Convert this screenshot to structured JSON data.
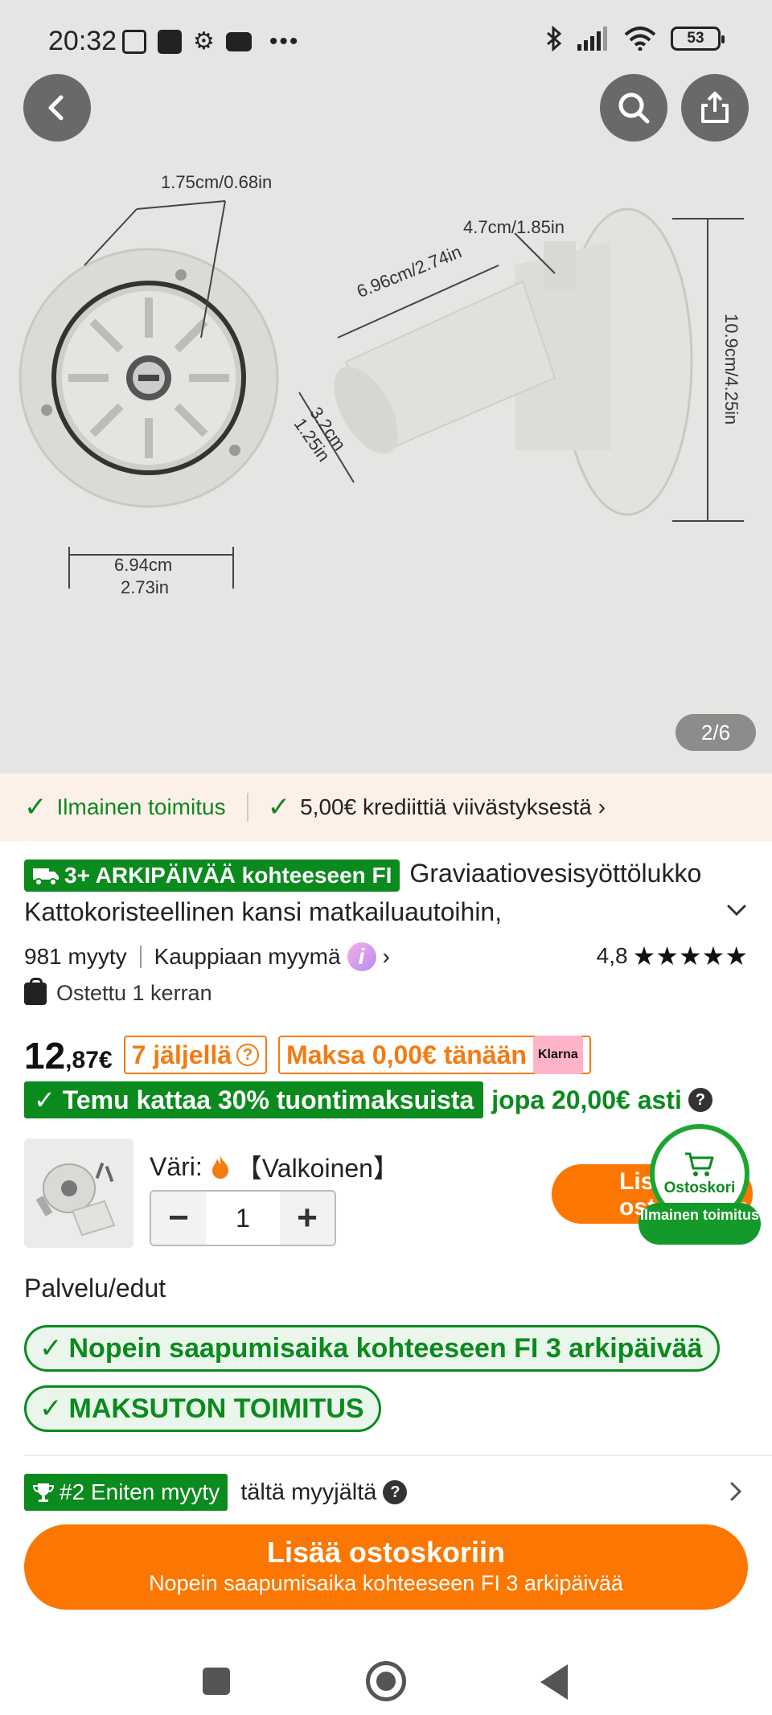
{
  "status_bar": {
    "time": "20:32",
    "battery": "53"
  },
  "gallery": {
    "counter": "2/6",
    "dimensions": {
      "top_left": "1.75cm/0.68in",
      "top_right": "4.7cm/1.85in",
      "diagonal": "6.96cm/2.74in",
      "height": "10.9cm/4.25in",
      "side": "3.2cm\n1.25in",
      "bottom_cm": "6.94cm",
      "bottom_in": "2.73in"
    }
  },
  "delivery_strip": {
    "free_shipping": "Ilmainen toimitus",
    "credit": "5,00€ krediittiä viivästyksestä"
  },
  "product": {
    "delivery_badge": "3+ ARKIPÄIVÄÄ kohteeseen FI",
    "title_line1": "Graviaatiovesisyöttölukko",
    "title_line2": "Kattokoristeellinen kansi matkailuautoihin,",
    "sold": "981 myyty",
    "seller": "Kauppiaan myymä",
    "rating": "4,8",
    "stars": "★★★★★",
    "bought": "Ostettu 1 kerran"
  },
  "price": {
    "integer": "12",
    "decimal": ",87€",
    "stock": "7 jäljellä",
    "pay_today": "Maksa 0,00€ tänään",
    "klarna": "Klarna"
  },
  "tariff": {
    "badge": "✓ Temu kattaa 30% tuontimaksuista",
    "extra": "jopa 20,00€ asti",
    "q": "?"
  },
  "variant": {
    "color_label": "Väri:",
    "color_value": "【Valkoinen】",
    "quantity": "1",
    "minus": "−",
    "plus": "+"
  },
  "floating_cart": {
    "add_label": "Lisää ostoskoriin",
    "cart_label": "Ostoskori",
    "free_ship": "Ilmainen toimitus"
  },
  "service": {
    "title": "Palvelu/edut",
    "pill1": "Nopein saapumisaika kohteeseen FI 3 arkipäivää",
    "pill2": "MAKSUTON TOIMITUS"
  },
  "ranking": {
    "badge": "#2 Eniten myyty",
    "text": "tältä myyjältä"
  },
  "cta": {
    "main": "Lisää ostoskoriin",
    "sub": "Nopein saapumisaika kohteeseen FI 3 arkipäivää"
  },
  "colors": {
    "accent_orange": "#fb7701",
    "green": "#0b8a1e"
  }
}
